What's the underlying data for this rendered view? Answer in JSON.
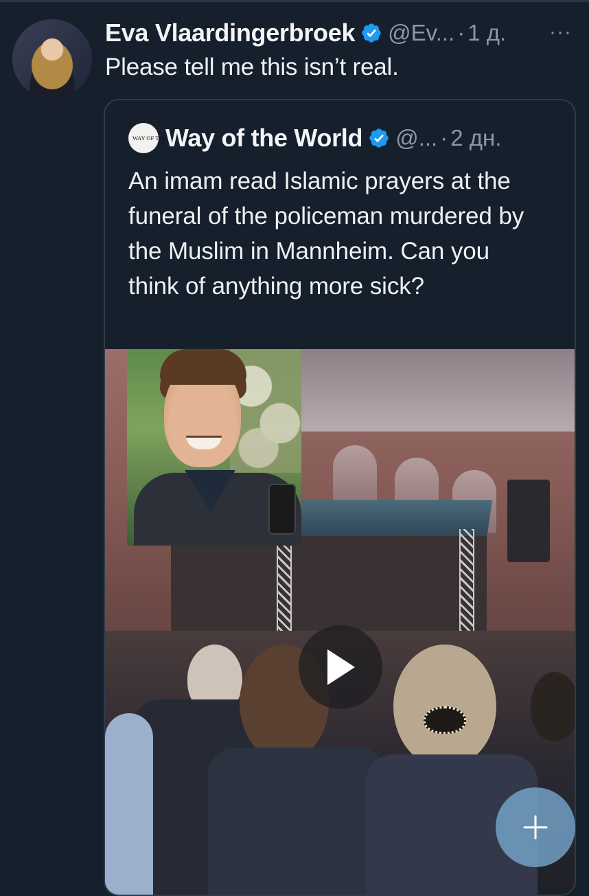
{
  "tweet": {
    "author_name": "Eva Vlaardingerbroek",
    "handle": "@Ev...",
    "separator": "·",
    "time": "1 д.",
    "more_label": "···",
    "text": "Please tell me this isn’t real."
  },
  "quoted_tweet": {
    "logo_text": "WAY OF THE WORLD",
    "author_name": "Way of the World",
    "handle": "@...",
    "separator": "·",
    "time": "2 дн.",
    "text": "An imam read Islamic prayers at the funeral of the policeman murdered by the Muslim in Mannheim. Can you think of anything more sick?",
    "media": {
      "type": "video",
      "play_icon": "play-icon"
    }
  },
  "fab": {
    "icon": "plus-icon"
  },
  "colors": {
    "background": "#16202d",
    "verified": "#1d9bf0",
    "muted_text": "#8b98a5",
    "primary_text": "#e7e9ea"
  }
}
